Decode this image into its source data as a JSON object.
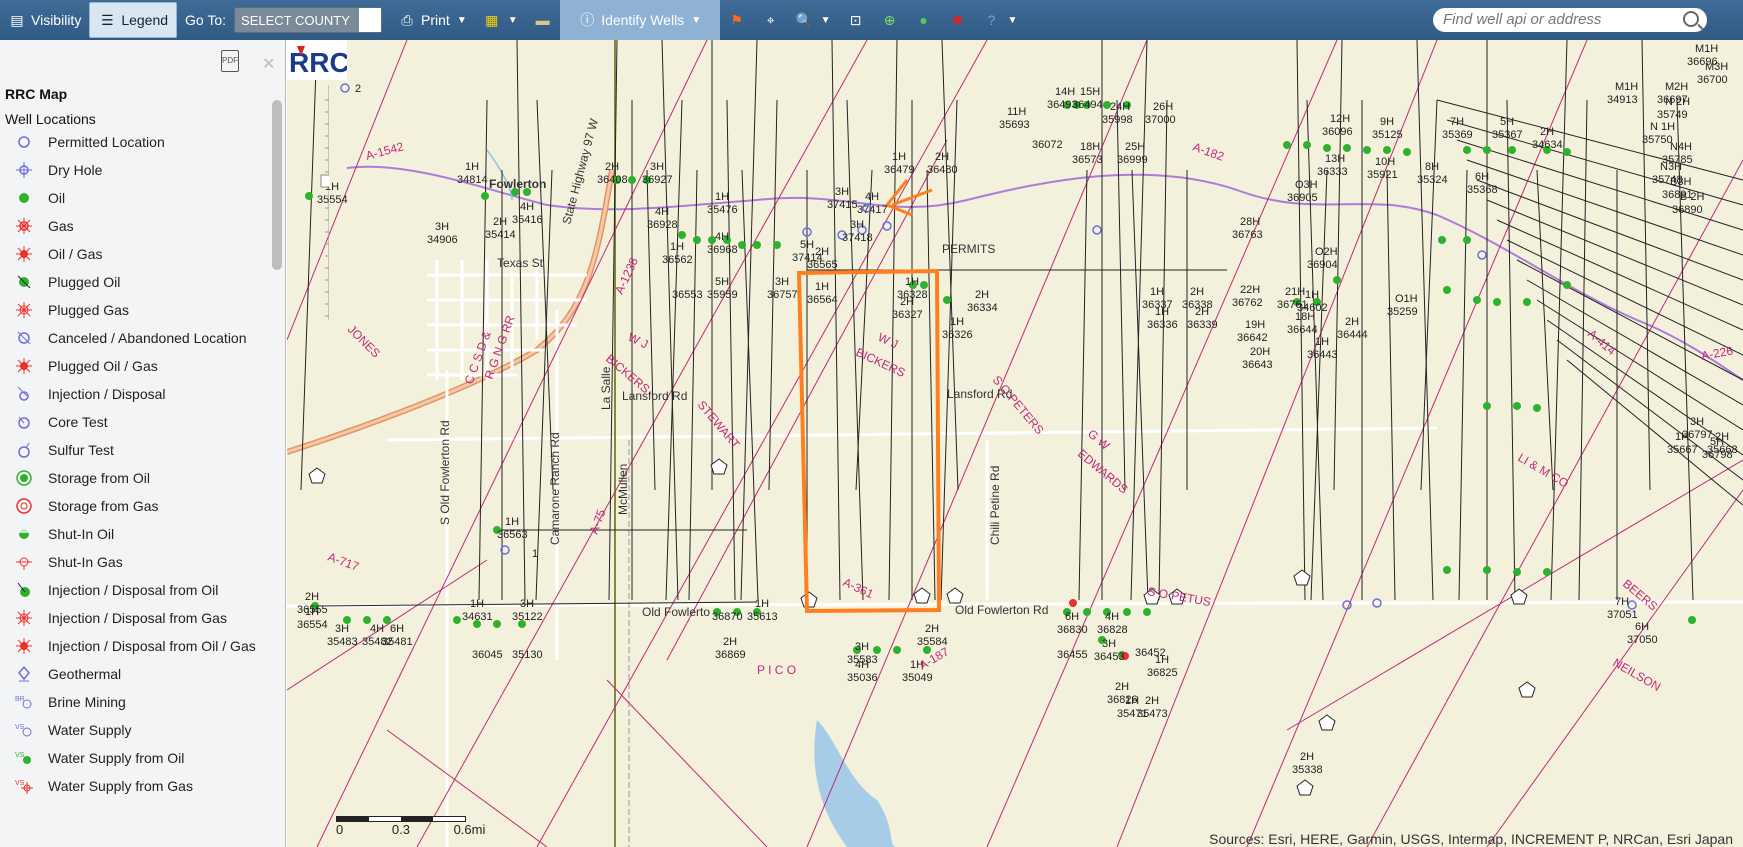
{
  "toolbar": {
    "visibility": "Visibility",
    "legend": "Legend",
    "goto": "Go To:",
    "county": "SELECT COUNTY",
    "print": "Print",
    "identify": "Identify Wells",
    "search_placeholder": "Find well api or address"
  },
  "legend": {
    "title": "RRC Map",
    "section": "Well Locations",
    "items": [
      {
        "label": "Permitted Location",
        "icon": "permitted-location-icon"
      },
      {
        "label": "Dry Hole",
        "icon": "dry-hole-icon"
      },
      {
        "label": "Oil",
        "icon": "oil-icon"
      },
      {
        "label": "Gas",
        "icon": "gas-icon"
      },
      {
        "label": "Oil / Gas",
        "icon": "oil-gas-icon"
      },
      {
        "label": "Plugged Oil",
        "icon": "plugged-oil-icon"
      },
      {
        "label": "Plugged Gas",
        "icon": "plugged-gas-icon"
      },
      {
        "label": "Canceled / Abandoned Location",
        "icon": "canceled-location-icon"
      },
      {
        "label": "Plugged Oil / Gas",
        "icon": "plugged-oil-gas-icon"
      },
      {
        "label": "Injection / Disposal",
        "icon": "injection-icon"
      },
      {
        "label": "Core Test",
        "icon": "core-test-icon"
      },
      {
        "label": "Sulfur Test",
        "icon": "sulfur-test-icon"
      },
      {
        "label": "Storage from Oil",
        "icon": "storage-oil-icon"
      },
      {
        "label": "Storage from Gas",
        "icon": "storage-gas-icon"
      },
      {
        "label": "Shut-In Oil",
        "icon": "shut-in-oil-icon"
      },
      {
        "label": "Shut-In Gas",
        "icon": "shut-in-gas-icon"
      },
      {
        "label": "Injection / Disposal from Oil",
        "icon": "injection-oil-icon"
      },
      {
        "label": "Injection / Disposal from Gas",
        "icon": "injection-gas-icon"
      },
      {
        "label": "Injection / Disposal from Oil / Gas",
        "icon": "injection-oil-gas-icon"
      },
      {
        "label": "Geothermal",
        "icon": "geothermal-icon"
      },
      {
        "label": "Brine Mining",
        "icon": "brine-mining-icon"
      },
      {
        "label": "Water Supply",
        "icon": "water-supply-icon"
      },
      {
        "label": "Water Supply from Oil",
        "icon": "water-supply-oil-icon"
      },
      {
        "label": "Water Supply from Gas",
        "icon": "water-supply-gas-icon"
      }
    ]
  },
  "map": {
    "town": "Fowlerton",
    "annotation": "PERMITS",
    "roads": {
      "texas_st": "Texas St",
      "lansford1": "Lansford Rd",
      "lansford2": "Lansford Rd",
      "old_fowlerton1": "Old Fowlerto",
      "old_fowlerton2": "Old Fowlerton Rd",
      "s_old_fowlerton": "S Old Fowlerton Rd",
      "camarone": "Camarone Ranch Rd",
      "chili": "Chili Petine Rd",
      "highway": "State Highway 97 W",
      "lasalle": "La Salle",
      "mcmullen": "McMullen"
    },
    "surveys": {
      "wj1": "W J",
      "bickers1": "BICKERS",
      "wj2": "W J",
      "bickers2": "BICKERS",
      "stewart": "STEWART",
      "jones": "JONES",
      "gw": "G W",
      "edwards": "EDWARDS",
      "sopeters": "S O PETERS",
      "sopetus": "S O PETUS",
      "pico": "P I C O",
      "limco": "LI & M CO",
      "beers": "BEERS",
      "neilson": "NEILSON",
      "ccsd1": "C C S D &",
      "rgngrr1": "R G N G RR",
      "a361": "A-361",
      "a187": "A-187",
      "a717": "A-717",
      "a1542": "A-1542",
      "a1238": "A-1238",
      "a75": "A-75",
      "a414": "A-414",
      "a226": "A-226",
      "a182": "A-182"
    },
    "wells": [
      {
        "t": "1H 35554"
      },
      {
        "t": "1H 34814"
      },
      {
        "t": "3H 34906"
      },
      {
        "t": "2H 35414"
      },
      {
        "t": "4H 35416"
      },
      {
        "t": "2H 36408"
      },
      {
        "t": "3H 36927"
      },
      {
        "t": "4H 36928"
      },
      {
        "t": "1H 35476"
      },
      {
        "t": "4H 36968"
      },
      {
        "t": "1H 36562"
      },
      {
        "t": "36553"
      },
      {
        "t": "5H 35959"
      },
      {
        "t": "3H 36757"
      },
      {
        "t": "2H 36565"
      },
      {
        "t": "1H 36564"
      },
      {
        "t": "3H 37415"
      },
      {
        "t": "4H 37417"
      },
      {
        "t": "3H 37418"
      },
      {
        "t": "5H 37414"
      },
      {
        "t": "1H 36479"
      },
      {
        "t": "2H 36480"
      },
      {
        "t": "1H 36328"
      },
      {
        "t": "2H 36334"
      },
      {
        "t": "2H 36327"
      },
      {
        "t": "1H 36326"
      },
      {
        "t": "14H 36493"
      },
      {
        "t": "15H 36494"
      },
      {
        "t": "11H 35693"
      },
      {
        "t": "24H 35998"
      },
      {
        "t": "26H 37000"
      },
      {
        "t": "36072"
      },
      {
        "t": "18H 36573"
      },
      {
        "t": "25H 36999"
      },
      {
        "t": "12H 36096"
      },
      {
        "t": "9H 35125"
      },
      {
        "t": "13H 36333"
      },
      {
        "t": "10H 35921"
      },
      {
        "t": "7H 35369"
      },
      {
        "t": "5H 35367"
      },
      {
        "t": "8H 35324"
      },
      {
        "t": "6H 35368"
      },
      {
        "t": "2H 34634"
      },
      {
        "t": "O3H 36905"
      },
      {
        "t": "O2H 36904"
      },
      {
        "t": "1H 34602"
      },
      {
        "t": "18H 36644"
      },
      {
        "t": "2H 36444"
      },
      {
        "t": "O1H 35259"
      },
      {
        "t": "1H 36443"
      },
      {
        "t": "19H 36642"
      },
      {
        "t": "20H 36643"
      },
      {
        "t": "22H 36762"
      },
      {
        "t": "21H 36761"
      },
      {
        "t": "1H 36337"
      },
      {
        "t": "2H 36338"
      },
      {
        "t": "1H 36336"
      },
      {
        "t": "2H 36339"
      },
      {
        "t": "28H 36763"
      },
      {
        "t": "1H 36563"
      },
      {
        "t": "2H 36555"
      },
      {
        "t": "1H 36554"
      },
      {
        "t": "3H 35483"
      },
      {
        "t": "4H 35482"
      },
      {
        "t": "6H 35481"
      },
      {
        "t": "1H 34631"
      },
      {
        "t": "3H 35122"
      },
      {
        "t": "36045"
      },
      {
        "t": "35130"
      },
      {
        "t": "36870"
      },
      {
        "t": "1H 35613"
      },
      {
        "t": "2H 36869"
      },
      {
        "t": "3H 35583"
      },
      {
        "t": "4H 35036"
      },
      {
        "t": "1H 35049"
      },
      {
        "t": "2H 35584"
      },
      {
        "t": "6H 36830"
      },
      {
        "t": "4H 36828"
      },
      {
        "t": "36455"
      },
      {
        "t": "3H 36453"
      },
      {
        "t": "36452"
      },
      {
        "t": "1H 36825"
      },
      {
        "t": "2H 36826"
      },
      {
        "t": "1H 35471"
      },
      {
        "t": "2H 35473"
      },
      {
        "t": "2H 35338"
      },
      {
        "t": "7H 37051"
      },
      {
        "t": "6H 37050"
      },
      {
        "t": "3H 36797"
      },
      {
        "t": "1H 35667"
      },
      {
        "t": "2H 35668"
      },
      {
        "t": "5H 36798"
      },
      {
        "t": "M1H 34913"
      },
      {
        "t": "M2H 36697"
      },
      {
        "t": "N 2H 35749"
      },
      {
        "t": "N 1H 35750"
      },
      {
        "t": "N4H 35785"
      },
      {
        "t": "N3H 35748"
      },
      {
        "t": "B3H 36891"
      },
      {
        "t": "B 2H 36890"
      },
      {
        "t": "M1H 36696"
      },
      {
        "t": "M3H 36700"
      }
    ],
    "scale": {
      "zero": "0",
      "mid": "0.3",
      "end": "0.6mi"
    },
    "zoom_marks": {
      "top": "2",
      "bottom": "1"
    },
    "sources": "Sources: Esri, HERE, Garmin, USGS, Intermap, INCREMENT P, NRCan, Esri Japan",
    "colors": {
      "oil": "#2fb12f",
      "survey": "#c02a78",
      "highlight": "#ff7f1f",
      "water": "#a6cce8",
      "road": "#e0946a"
    }
  }
}
